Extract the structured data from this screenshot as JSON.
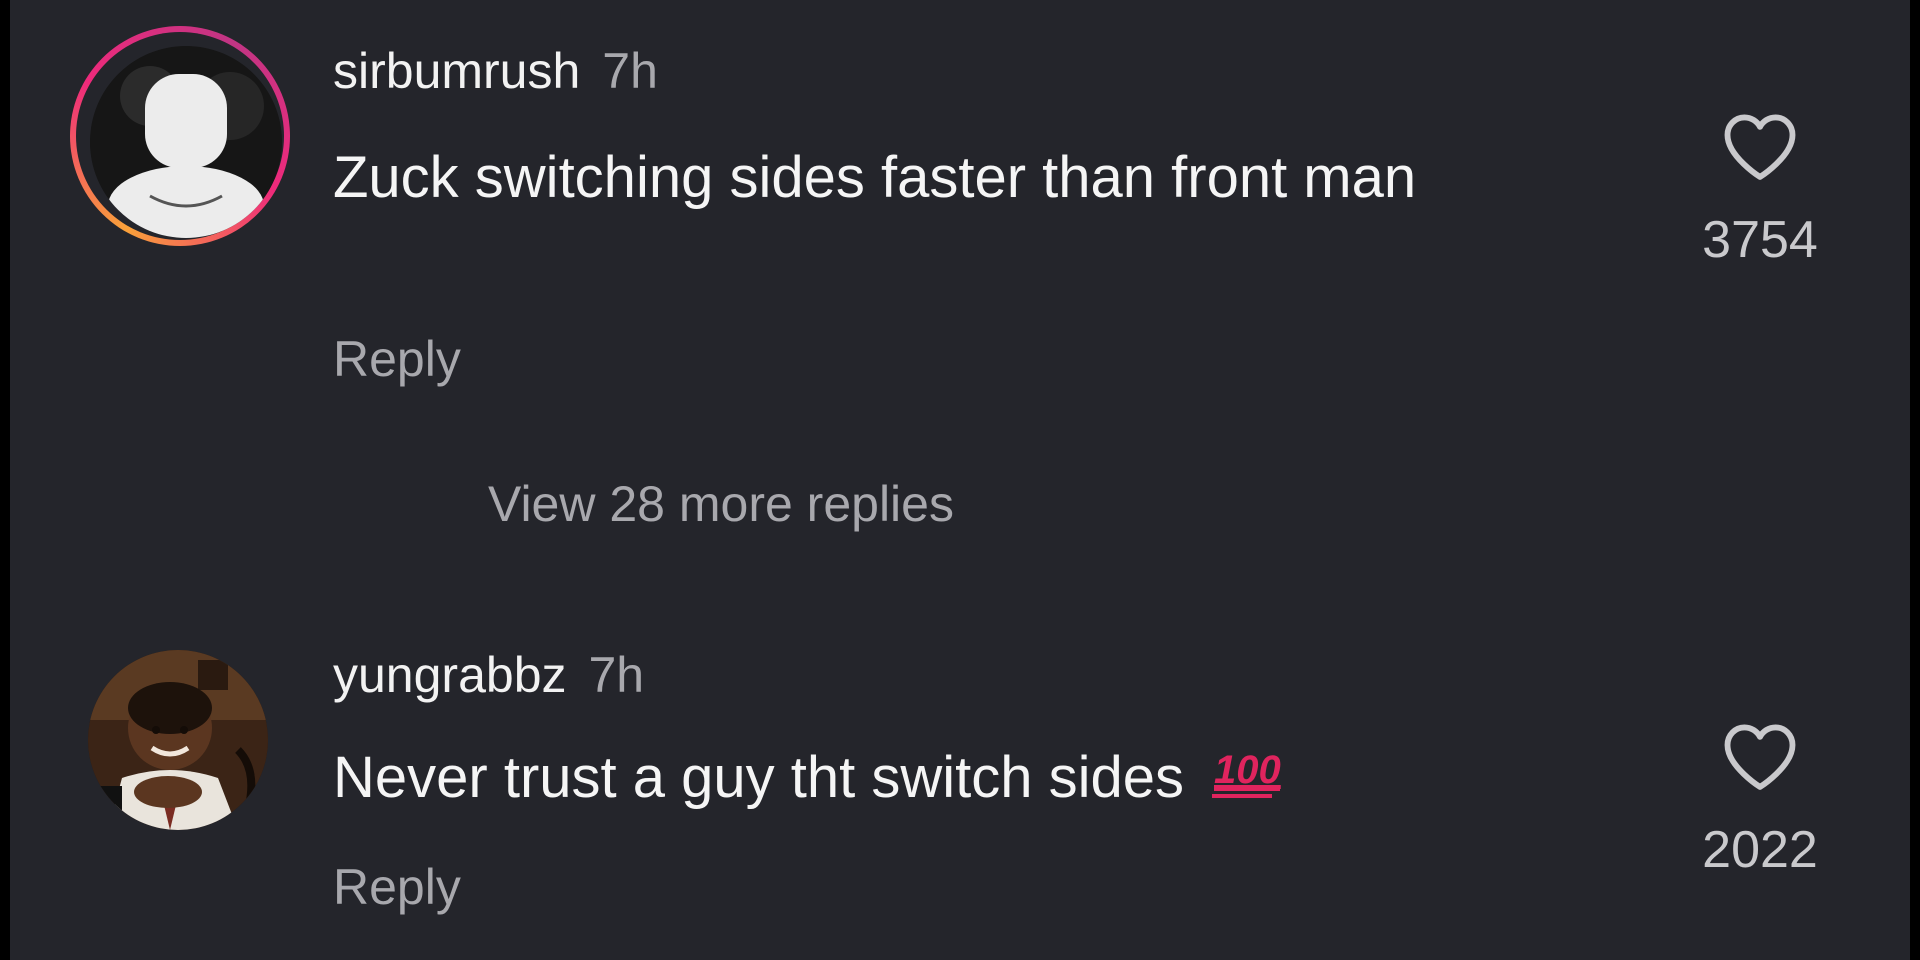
{
  "comments": [
    {
      "username": "sirbumrush",
      "time": "7h",
      "text": "Zuck switching sides faster than front man",
      "reply_label": "Reply",
      "like_count": "3754",
      "like_icon": "heart-outline-icon",
      "avatar_ring": true,
      "view_replies_label": "View 28 more replies"
    },
    {
      "username": "yungrabbz",
      "time": "7h",
      "text": "Never trust a guy tht switch sides",
      "emoji": "hundred-points-emoji",
      "emoji_text": "100",
      "reply_label": "Reply",
      "like_count": "2022",
      "like_icon": "heart-outline-icon"
    }
  ],
  "colors": {
    "background": "#24252b",
    "text_primary": "#f5f5f5",
    "text_secondary": "#a8a8ad",
    "emoji_red": "#e0245e"
  }
}
